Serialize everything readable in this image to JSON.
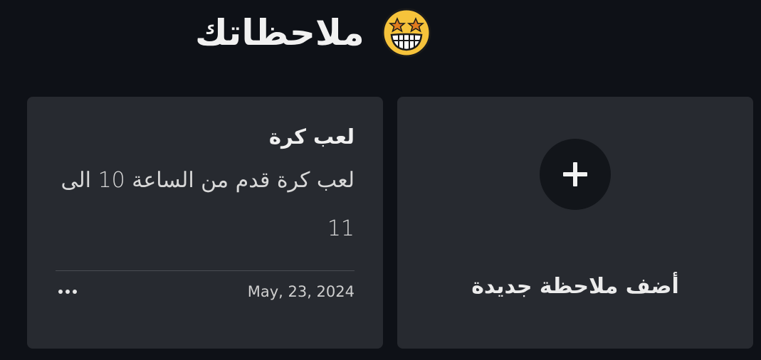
{
  "header": {
    "title": "ملاحظاتك",
    "emoji_icon": "star-struck-face-icon"
  },
  "add_card": {
    "label": "أضف ملاحظة جديدة",
    "icon": "plus-icon"
  },
  "notes": [
    {
      "title": "لعب كرة",
      "body": "لعب كرة قدم من الساعة 10 الى 11",
      "date": "May, 23, 2024",
      "menu_icon": "more-dots-icon"
    }
  ],
  "colors": {
    "background": "#0e1117",
    "card": "#272a30",
    "add_circle": "#12151a",
    "emoji_face": "#f6c33b"
  }
}
